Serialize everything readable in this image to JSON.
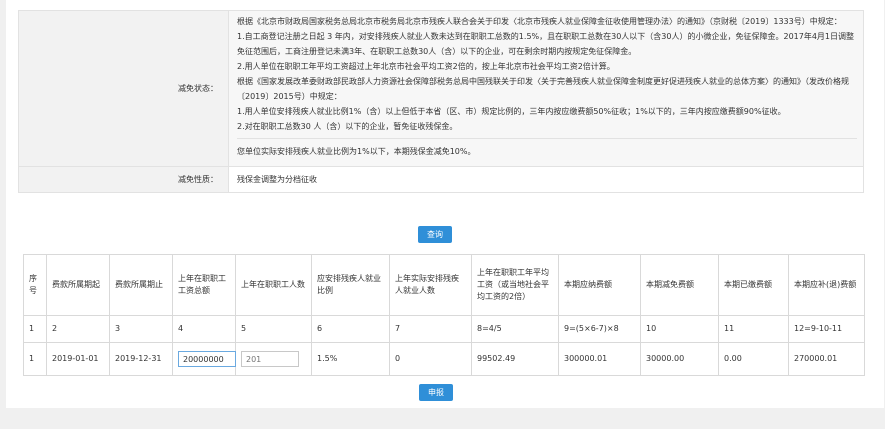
{
  "info": {
    "status_label": "减免状态：",
    "policy": {
      "p1": "根据《北京市财政局国家税务总局北京市税务局北京市残疾人联合会关于印发〈北京市残疾人就业保障金征收使用管理办法〉的通知》（京财税〔2019〕1333号）中规定：",
      "p2": "1.自工商登记注册之日起 3 年内，对安排残疾人就业人数未达到在职职工总数的1.5%，且在职职工总数在30人以下（含30人）的小微企业，免征保障金。2017年4月1日调整免征范围后，工商注册登记未满3年、在职职工总数30人（含）以下的企业，可在剩余时期内按规定免征保障金。",
      "p3": "2.用人单位在职职工年平均工资超过上年北京市社会平均工资2倍的，按上年北京市社会平均工资2倍计算。",
      "p4": "根据《国家发展改革委财政部民政部人力资源社会保障部税务总局中国残联关于印发〈关于完善残疾人就业保障金制度更好促进残疾人就业的总体方案〉的通知》（发改价格规〔2019〕2015号）中规定：",
      "p5": "1.用人单位安排残疾人就业比例1%（含）以上但低于本省（区、市）规定比例的，三年内按应缴费额50%征收；1%以下的，三年内按应缴费额90%征收。",
      "p6": "2.对在职职工总数30 人（含）以下的企业，暂免征收残保金。",
      "summary": "您单位实际安排残疾人就业比例为1%以下，本期残保金减免10%。"
    },
    "nature_label": "减免性质：",
    "nature_value": "残保金调整为分档征收"
  },
  "buttons": {
    "query": "查询",
    "submit": "申报"
  },
  "table": {
    "headers": [
      "序号",
      "费款所属期起",
      "费款所属期止",
      "上年在职职工工资总额",
      "上年在职职工人数",
      "应安排残疾人就业比例",
      "上年实际安排残疾人就业人数",
      "上年在职职工年平均工资（或当地社会平均工资的2倍）",
      "本期应纳费额",
      "本期减免费额",
      "本期已缴费额",
      "本期应补(退)费额"
    ],
    "index_row": [
      "1",
      "2",
      "3",
      "4",
      "5",
      "6",
      "7",
      "8=4/5",
      "9=(5×6-7)×8",
      "10",
      "11",
      "12=9-10-11"
    ],
    "data_row": {
      "seq": "1",
      "start": "2019-01-01",
      "end": "2019-12-31",
      "salary_total": "20000000",
      "staff_count_placeholder": "201",
      "ratio": "1.5%",
      "disabled_count": "0",
      "avg_salary": "99502.49",
      "payable": "300000.01",
      "reduction": "30000.00",
      "paid": "0.00",
      "balance": "270000.01"
    }
  }
}
